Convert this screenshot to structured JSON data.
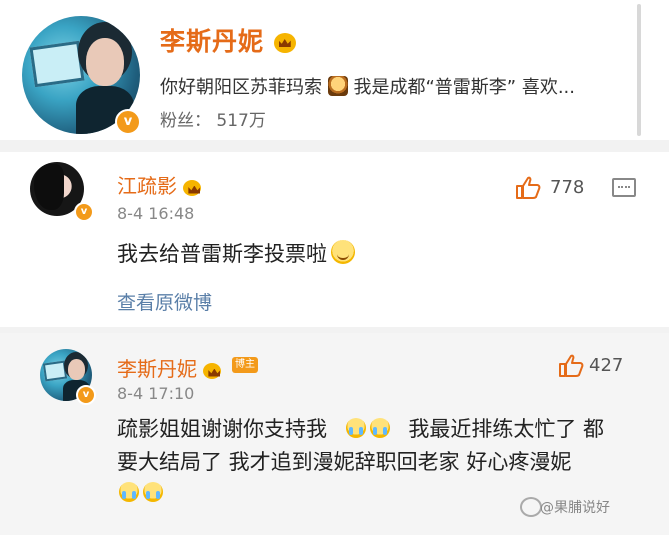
{
  "profile": {
    "name": "李斯丹妮",
    "bio_part1": "你好朝阳区苏菲玛索",
    "bio_part2": "我是成都“普雷斯李” 喜欢...",
    "fans_label": "粉丝：",
    "fans_count": "517万",
    "verified_badge": "v"
  },
  "comments": [
    {
      "name": "江疏影",
      "time": "8-4 16:48",
      "text": "我去给普雷斯李投票啦",
      "likes": "778",
      "view_original": "查看原微博",
      "verified_badge": "v"
    },
    {
      "name": "李斯丹妮",
      "tag": "博主",
      "time": "8-4 17:10",
      "line1_a": "疏影姐姐谢谢你支持我",
      "line1_b": "我最近排练太忙了 都",
      "line2": "要大结局了  我才追到漫妮辞职回老家 好心疼漫妮",
      "likes": "427",
      "verified_badge": "v"
    }
  ],
  "watermark": "@果脯说好",
  "colors": {
    "name": "#e56b18",
    "link": "#5a7fa8",
    "muted": "#888888",
    "badge": "#f39a1a"
  },
  "icons": [
    "crown-icon",
    "like-icon",
    "reply-icon",
    "smile-emoji",
    "cry-emoji",
    "verified-icon"
  ]
}
